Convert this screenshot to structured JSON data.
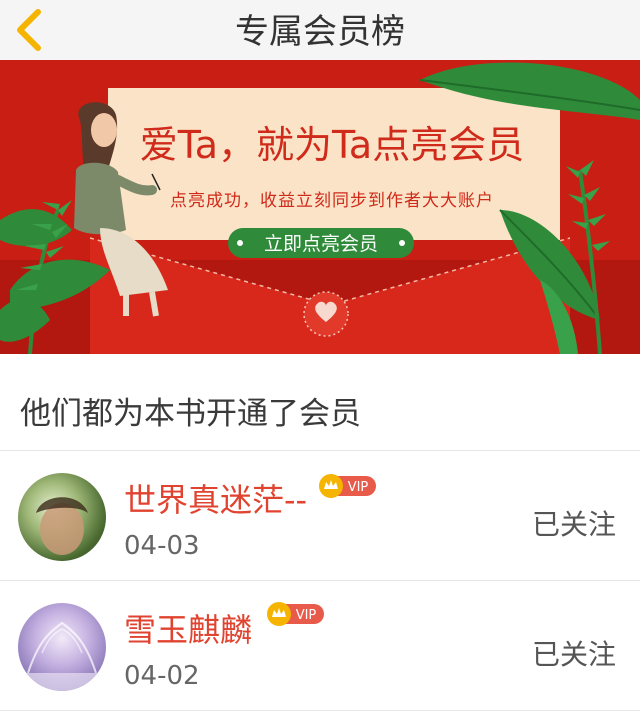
{
  "header": {
    "title": "专属会员榜",
    "back_icon": "chevron-left-icon",
    "accent": "#f5b400"
  },
  "banner": {
    "headline": "爱Ta，就为Ta点亮会员",
    "subtext": "点亮成功，收益立刻同步到作者大大账户",
    "button_label": "立即点亮会员",
    "colors": {
      "red": "#d42a1c",
      "cream": "#fbe3c8",
      "green": "#2f8b3a"
    }
  },
  "section_title": "他们都为本书开通了会员",
  "members": [
    {
      "name": "世界真迷茫--",
      "badge": "VIP",
      "date": "04-03",
      "follow_label": "已关注"
    },
    {
      "name": "雪玉麒麟",
      "badge": "VIP",
      "date": "04-02",
      "follow_label": "已关注"
    }
  ]
}
